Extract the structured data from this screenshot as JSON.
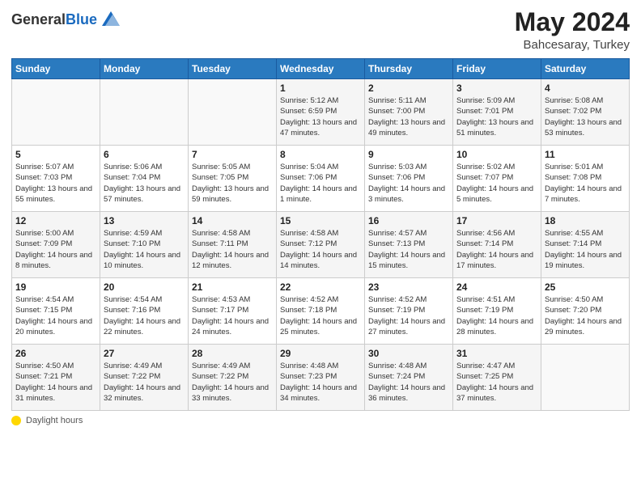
{
  "logo": {
    "general": "General",
    "blue": "Blue"
  },
  "header": {
    "month_year": "May 2024",
    "location": "Bahcesaray, Turkey"
  },
  "days_of_week": [
    "Sunday",
    "Monday",
    "Tuesday",
    "Wednesday",
    "Thursday",
    "Friday",
    "Saturday"
  ],
  "weeks": [
    [
      {
        "num": "",
        "sunrise": "",
        "sunset": "",
        "daylight": ""
      },
      {
        "num": "",
        "sunrise": "",
        "sunset": "",
        "daylight": ""
      },
      {
        "num": "",
        "sunrise": "",
        "sunset": "",
        "daylight": ""
      },
      {
        "num": "1",
        "sunrise": "Sunrise: 5:12 AM",
        "sunset": "Sunset: 6:59 PM",
        "daylight": "Daylight: 13 hours and 47 minutes."
      },
      {
        "num": "2",
        "sunrise": "Sunrise: 5:11 AM",
        "sunset": "Sunset: 7:00 PM",
        "daylight": "Daylight: 13 hours and 49 minutes."
      },
      {
        "num": "3",
        "sunrise": "Sunrise: 5:09 AM",
        "sunset": "Sunset: 7:01 PM",
        "daylight": "Daylight: 13 hours and 51 minutes."
      },
      {
        "num": "4",
        "sunrise": "Sunrise: 5:08 AM",
        "sunset": "Sunset: 7:02 PM",
        "daylight": "Daylight: 13 hours and 53 minutes."
      }
    ],
    [
      {
        "num": "5",
        "sunrise": "Sunrise: 5:07 AM",
        "sunset": "Sunset: 7:03 PM",
        "daylight": "Daylight: 13 hours and 55 minutes."
      },
      {
        "num": "6",
        "sunrise": "Sunrise: 5:06 AM",
        "sunset": "Sunset: 7:04 PM",
        "daylight": "Daylight: 13 hours and 57 minutes."
      },
      {
        "num": "7",
        "sunrise": "Sunrise: 5:05 AM",
        "sunset": "Sunset: 7:05 PM",
        "daylight": "Daylight: 13 hours and 59 minutes."
      },
      {
        "num": "8",
        "sunrise": "Sunrise: 5:04 AM",
        "sunset": "Sunset: 7:06 PM",
        "daylight": "Daylight: 14 hours and 1 minute."
      },
      {
        "num": "9",
        "sunrise": "Sunrise: 5:03 AM",
        "sunset": "Sunset: 7:06 PM",
        "daylight": "Daylight: 14 hours and 3 minutes."
      },
      {
        "num": "10",
        "sunrise": "Sunrise: 5:02 AM",
        "sunset": "Sunset: 7:07 PM",
        "daylight": "Daylight: 14 hours and 5 minutes."
      },
      {
        "num": "11",
        "sunrise": "Sunrise: 5:01 AM",
        "sunset": "Sunset: 7:08 PM",
        "daylight": "Daylight: 14 hours and 7 minutes."
      }
    ],
    [
      {
        "num": "12",
        "sunrise": "Sunrise: 5:00 AM",
        "sunset": "Sunset: 7:09 PM",
        "daylight": "Daylight: 14 hours and 8 minutes."
      },
      {
        "num": "13",
        "sunrise": "Sunrise: 4:59 AM",
        "sunset": "Sunset: 7:10 PM",
        "daylight": "Daylight: 14 hours and 10 minutes."
      },
      {
        "num": "14",
        "sunrise": "Sunrise: 4:58 AM",
        "sunset": "Sunset: 7:11 PM",
        "daylight": "Daylight: 14 hours and 12 minutes."
      },
      {
        "num": "15",
        "sunrise": "Sunrise: 4:58 AM",
        "sunset": "Sunset: 7:12 PM",
        "daylight": "Daylight: 14 hours and 14 minutes."
      },
      {
        "num": "16",
        "sunrise": "Sunrise: 4:57 AM",
        "sunset": "Sunset: 7:13 PM",
        "daylight": "Daylight: 14 hours and 15 minutes."
      },
      {
        "num": "17",
        "sunrise": "Sunrise: 4:56 AM",
        "sunset": "Sunset: 7:14 PM",
        "daylight": "Daylight: 14 hours and 17 minutes."
      },
      {
        "num": "18",
        "sunrise": "Sunrise: 4:55 AM",
        "sunset": "Sunset: 7:14 PM",
        "daylight": "Daylight: 14 hours and 19 minutes."
      }
    ],
    [
      {
        "num": "19",
        "sunrise": "Sunrise: 4:54 AM",
        "sunset": "Sunset: 7:15 PM",
        "daylight": "Daylight: 14 hours and 20 minutes."
      },
      {
        "num": "20",
        "sunrise": "Sunrise: 4:54 AM",
        "sunset": "Sunset: 7:16 PM",
        "daylight": "Daylight: 14 hours and 22 minutes."
      },
      {
        "num": "21",
        "sunrise": "Sunrise: 4:53 AM",
        "sunset": "Sunset: 7:17 PM",
        "daylight": "Daylight: 14 hours and 24 minutes."
      },
      {
        "num": "22",
        "sunrise": "Sunrise: 4:52 AM",
        "sunset": "Sunset: 7:18 PM",
        "daylight": "Daylight: 14 hours and 25 minutes."
      },
      {
        "num": "23",
        "sunrise": "Sunrise: 4:52 AM",
        "sunset": "Sunset: 7:19 PM",
        "daylight": "Daylight: 14 hours and 27 minutes."
      },
      {
        "num": "24",
        "sunrise": "Sunrise: 4:51 AM",
        "sunset": "Sunset: 7:19 PM",
        "daylight": "Daylight: 14 hours and 28 minutes."
      },
      {
        "num": "25",
        "sunrise": "Sunrise: 4:50 AM",
        "sunset": "Sunset: 7:20 PM",
        "daylight": "Daylight: 14 hours and 29 minutes."
      }
    ],
    [
      {
        "num": "26",
        "sunrise": "Sunrise: 4:50 AM",
        "sunset": "Sunset: 7:21 PM",
        "daylight": "Daylight: 14 hours and 31 minutes."
      },
      {
        "num": "27",
        "sunrise": "Sunrise: 4:49 AM",
        "sunset": "Sunset: 7:22 PM",
        "daylight": "Daylight: 14 hours and 32 minutes."
      },
      {
        "num": "28",
        "sunrise": "Sunrise: 4:49 AM",
        "sunset": "Sunset: 7:22 PM",
        "daylight": "Daylight: 14 hours and 33 minutes."
      },
      {
        "num": "29",
        "sunrise": "Sunrise: 4:48 AM",
        "sunset": "Sunset: 7:23 PM",
        "daylight": "Daylight: 14 hours and 34 minutes."
      },
      {
        "num": "30",
        "sunrise": "Sunrise: 4:48 AM",
        "sunset": "Sunset: 7:24 PM",
        "daylight": "Daylight: 14 hours and 36 minutes."
      },
      {
        "num": "31",
        "sunrise": "Sunrise: 4:47 AM",
        "sunset": "Sunset: 7:25 PM",
        "daylight": "Daylight: 14 hours and 37 minutes."
      },
      {
        "num": "",
        "sunrise": "",
        "sunset": "",
        "daylight": ""
      }
    ]
  ],
  "footer": {
    "daylight_label": "Daylight hours"
  }
}
